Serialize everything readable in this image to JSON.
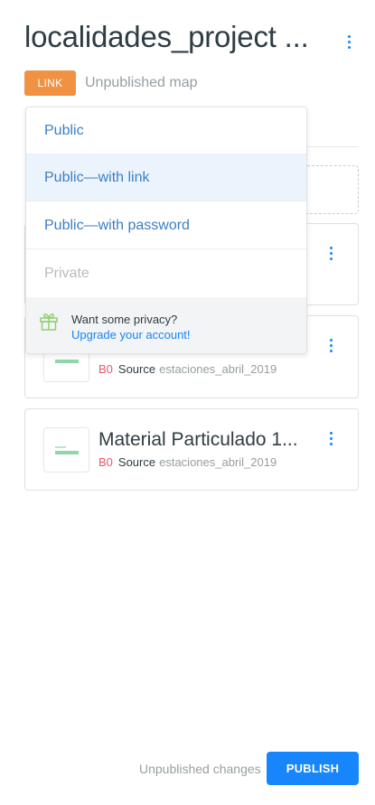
{
  "header": {
    "title": "localidades_project ...",
    "badge": "LINK",
    "status": "Unpublished map"
  },
  "privacy_menu": {
    "options": [
      {
        "label": "Public",
        "state": "normal"
      },
      {
        "label": "Public—with link",
        "state": "selected"
      },
      {
        "label": "Public—with password",
        "state": "normal"
      },
      {
        "label": "Private",
        "state": "disabled"
      }
    ],
    "promo_text": "Want some privacy?",
    "promo_link": "Upgrade your account!"
  },
  "layers": [
    {
      "name": "",
      "code": "B0",
      "source_label": "Source",
      "dataset": "estaciones_abril_2019"
    },
    {
      "name": "Material Particulado 1...",
      "code": "B0",
      "source_label": "Source",
      "dataset": "estaciones_abril_2019"
    }
  ],
  "footer": {
    "changes_text": "Unpublished changes",
    "publish_label": "PUBLISH"
  },
  "colors": {
    "accent": "#1785fb",
    "badge": "#f19243",
    "source_code": "#e05a6a"
  }
}
